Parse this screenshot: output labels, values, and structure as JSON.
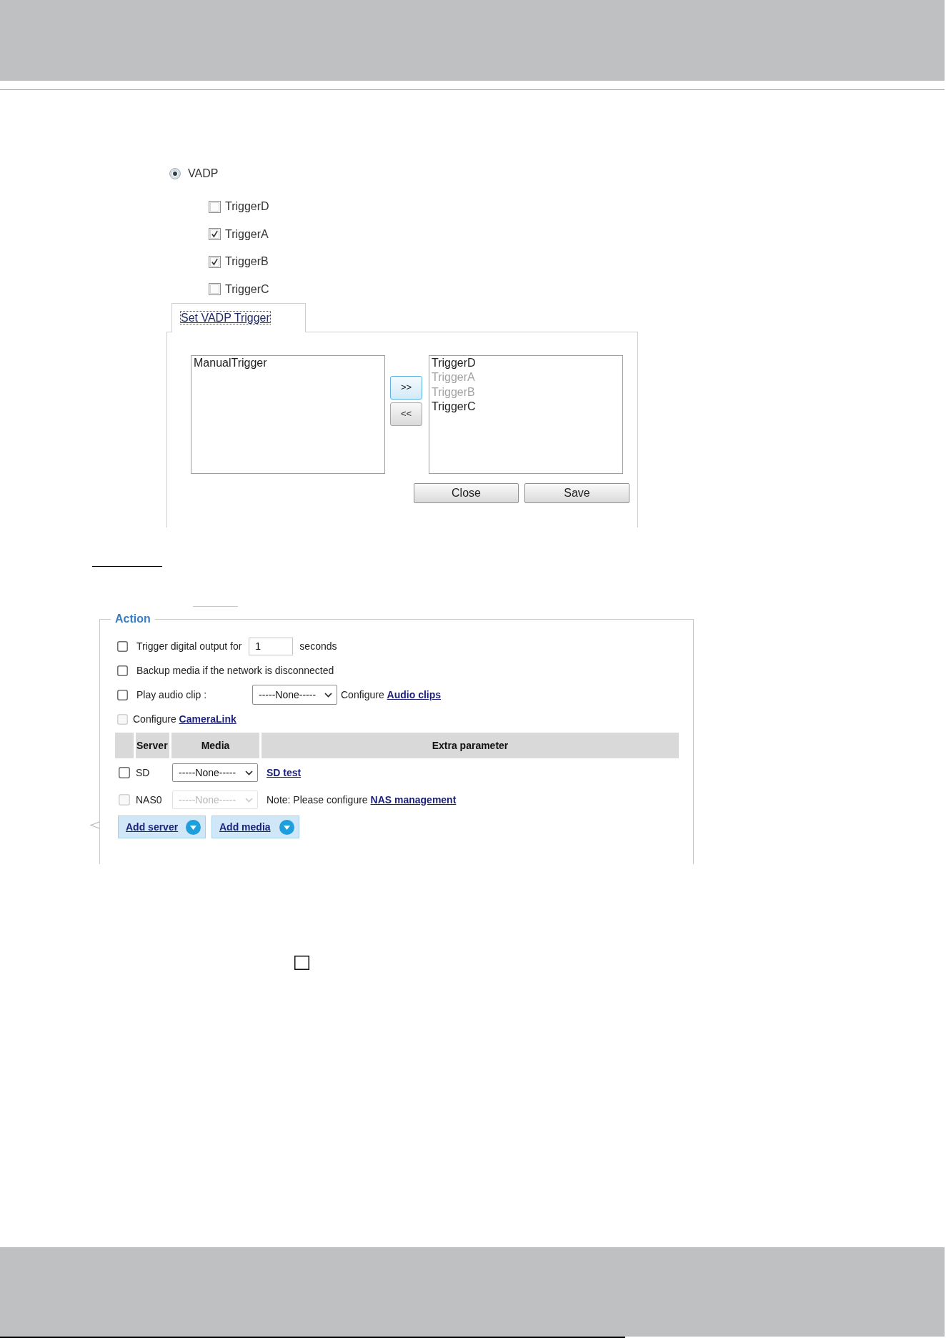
{
  "vadp_option": {
    "label": "VADP",
    "selected": true
  },
  "triggers": [
    {
      "label": "TriggerD",
      "checked": false
    },
    {
      "label": "TriggerA",
      "checked": true
    },
    {
      "label": "TriggerB",
      "checked": true
    },
    {
      "label": "TriggerC",
      "checked": false
    }
  ],
  "trigger_dialog": {
    "tab": {
      "label": "Set VADP Trigger",
      "selected": true
    },
    "source_list": [
      {
        "label": "ManualTrigger",
        "disabled": false
      }
    ],
    "move_buttons": [
      {
        "label": ">>",
        "focused": true
      },
      {
        "label": "<<",
        "focused": false
      }
    ],
    "target_list": [
      {
        "label": "TriggerD",
        "disabled": false
      },
      {
        "label": "TriggerA",
        "disabled": true
      },
      {
        "label": "TriggerB",
        "disabled": true
      },
      {
        "label": "TriggerC",
        "disabled": false
      }
    ],
    "buttons": [
      "Close",
      "Save"
    ]
  },
  "action": {
    "legend": "Action",
    "options": [
      {
        "kind": "duration",
        "checked": false,
        "disabled": false,
        "label": "Trigger digital output for",
        "value": "1",
        "unit": "seconds"
      },
      {
        "kind": "plain",
        "checked": false,
        "disabled": false,
        "label": "Backup media if the network is disconnected"
      },
      {
        "kind": "audio",
        "checked": false,
        "disabled": false,
        "label": "Play audio clip :",
        "select": "-----None-----",
        "prefix": "Configure",
        "link": "Audio clips"
      },
      {
        "kind": "link",
        "checked": false,
        "disabled": true,
        "prefix": "Configure",
        "link": "CameraLink"
      }
    ],
    "table": {
      "columns": [
        "Server",
        "Media",
        "Extra parameter"
      ],
      "rows": [
        {
          "checked": false,
          "disabled": false,
          "server": "SD",
          "media": "-----None-----",
          "extra": {
            "kind": "link",
            "link": "SD test"
          }
        },
        {
          "checked": false,
          "disabled": true,
          "server": "NAS0",
          "media": "-----None-----",
          "extra": {
            "kind": "note",
            "text": "Note: Please configure",
            "link": "NAS management"
          }
        }
      ]
    },
    "buttons": [
      "Add server",
      "Add media"
    ]
  },
  "checkbox": {
    "checked": false
  }
}
